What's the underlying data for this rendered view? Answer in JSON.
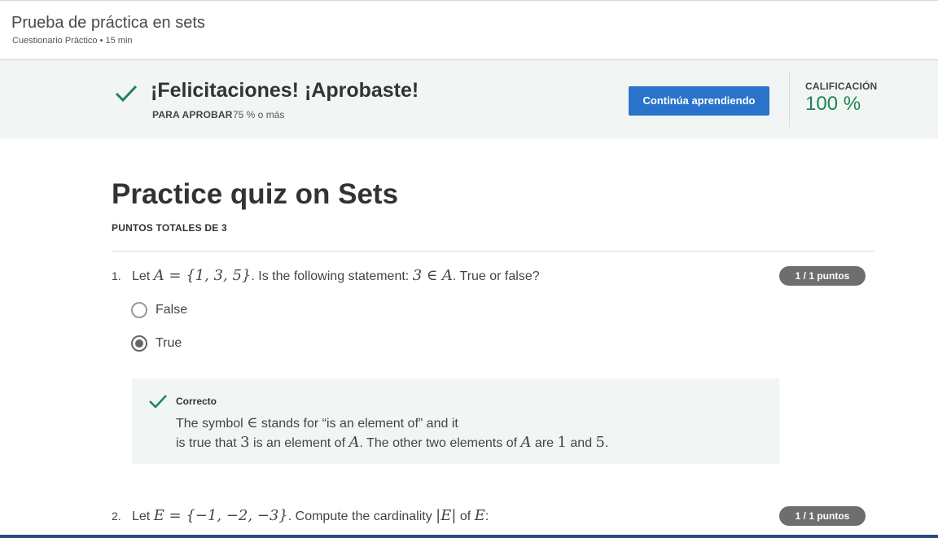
{
  "header": {
    "title": "Prueba de práctica en sets",
    "subtitle": "Cuestionario Práctico • 15 min"
  },
  "banner": {
    "congrats": "¡Felicitaciones! ¡Aprobaste!",
    "pass_label": "PARA APROBAR",
    "pass_value": "75 % o más",
    "continue_label": "Continúa aprendiendo",
    "grade_label": "CALIFICACIÓN",
    "grade_value": "100 %",
    "icon": "check-icon",
    "accent_color": "#1f8354",
    "button_color": "#2a73cc"
  },
  "quiz": {
    "title": "Practice quiz on Sets",
    "points_total": "PUNTOS TOTALES DE 3"
  },
  "questions": [
    {
      "number": "1.",
      "text_a": "Let ",
      "text_b": "A = {1, 3, 5}",
      "text_c": ". Is the following statement: ",
      "text_d": "3 ∈ A",
      "text_e": ".  True or false?",
      "points": "1 / 1 puntos",
      "options": [
        {
          "label": "False",
          "selected": false
        },
        {
          "label": "True",
          "selected": true
        }
      ],
      "feedback": {
        "title": "Correcto",
        "line1_a": "The symbol ",
        "line1_b": "∈",
        "line1_c": " stands for “is an element of” and it",
        "line2_a": "is true that ",
        "line2_b": "3",
        "line2_c": " is an element of ",
        "line2_d": "A",
        "line2_e": ". The other two elements of ",
        "line2_f": "A",
        "line2_g": " are ",
        "line2_h": "1",
        "line2_i": " and ",
        "line2_j": "5",
        "line2_k": "."
      }
    },
    {
      "number": "2.",
      "text_a": "Let ",
      "text_b": "E = {−1, −2, −3}",
      "text_c": ". Compute the cardinality ",
      "text_d": "|E|",
      "text_e": " of ",
      "text_f": "E",
      "text_g": ":",
      "points": "1 / 1 puntos"
    }
  ]
}
